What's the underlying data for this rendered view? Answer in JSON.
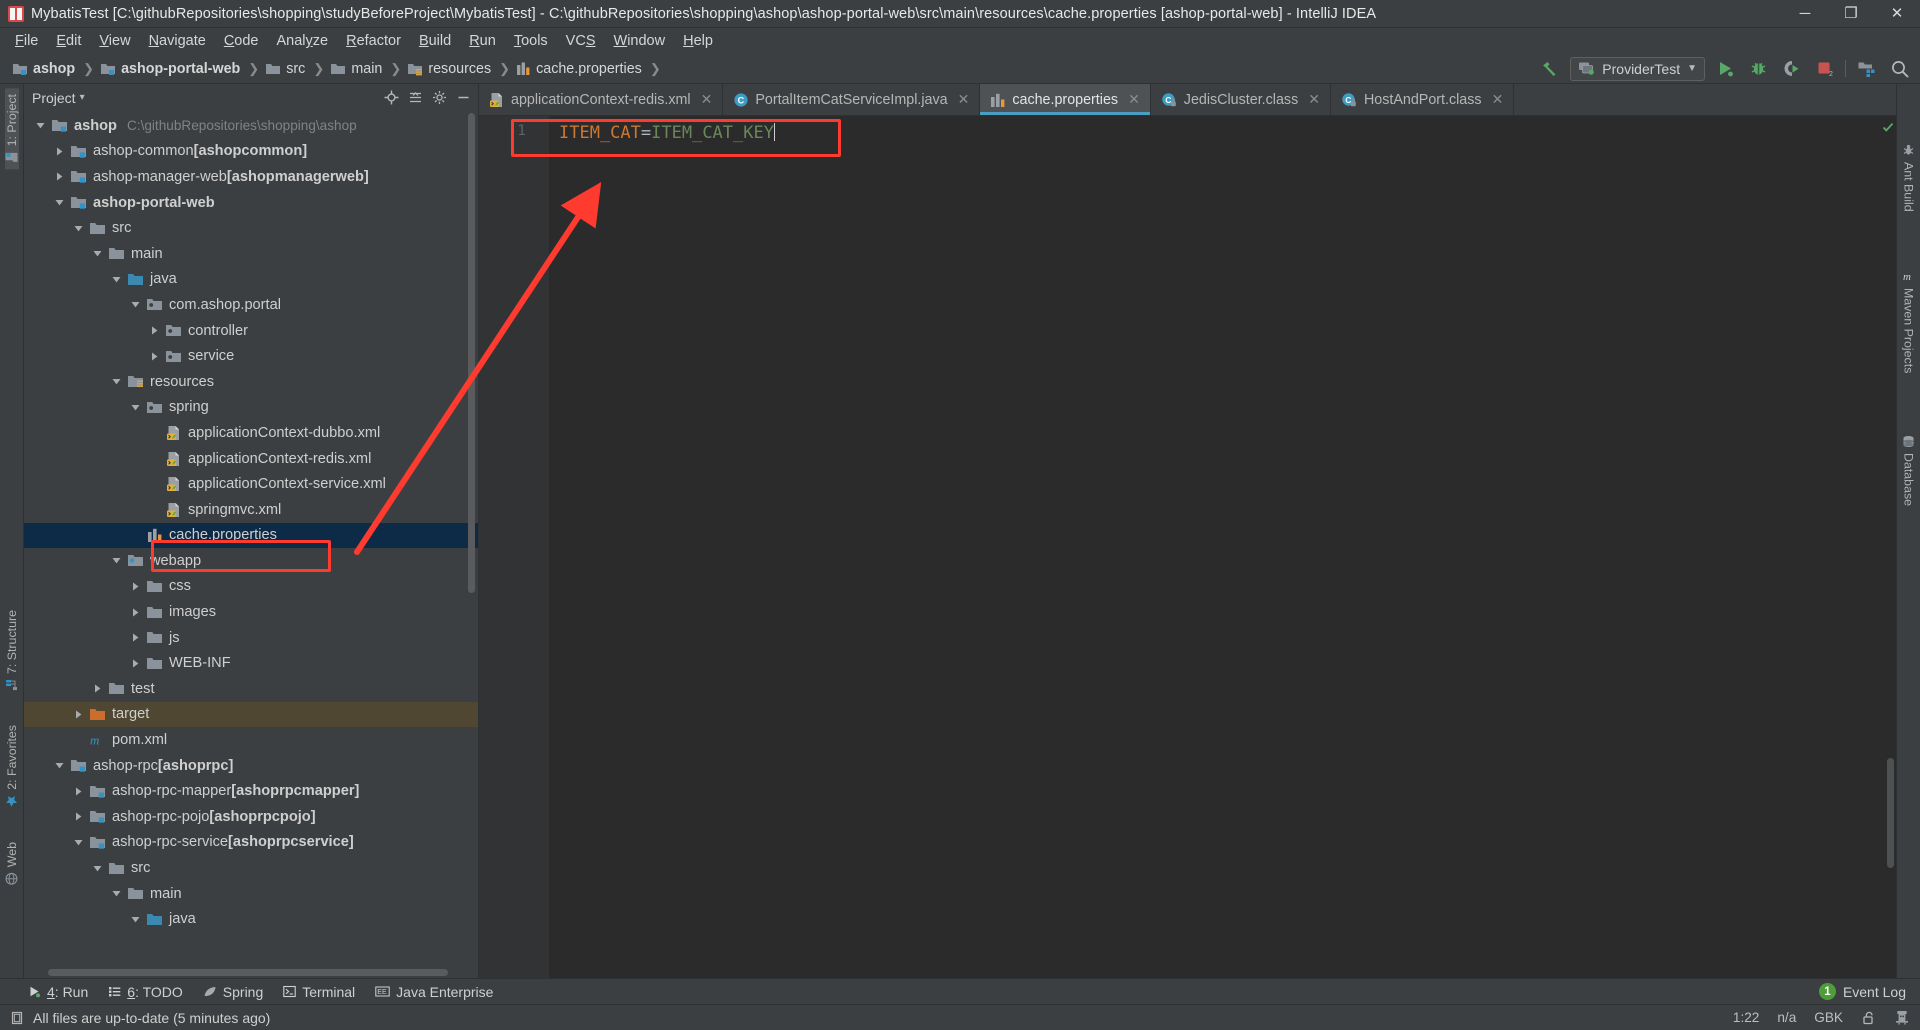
{
  "window": {
    "title": "MybatisTest [C:\\githubRepositories\\shopping\\studyBeforeProject\\MybatisTest] - C:\\githubRepositories\\shopping\\ashop\\ashop-portal-web\\src\\main\\resources\\cache.properties [ashop-portal-web] - IntelliJ IDEA",
    "app_icon": "intellij-idea-icon",
    "minimize": "─",
    "maximize": "❐",
    "close": "✕"
  },
  "menubar": {
    "items": [
      {
        "label": "File",
        "mnemonic": "F"
      },
      {
        "label": "Edit",
        "mnemonic": "E"
      },
      {
        "label": "View",
        "mnemonic": "V"
      },
      {
        "label": "Navigate",
        "mnemonic": "N"
      },
      {
        "label": "Code",
        "mnemonic": "C"
      },
      {
        "label": "Analyze",
        "mnemonic": "y"
      },
      {
        "label": "Refactor",
        "mnemonic": "R"
      },
      {
        "label": "Build",
        "mnemonic": "B"
      },
      {
        "label": "Run",
        "mnemonic": "R"
      },
      {
        "label": "Tools",
        "mnemonic": "T"
      },
      {
        "label": "VCS",
        "mnemonic": "S"
      },
      {
        "label": "Window",
        "mnemonic": "W"
      },
      {
        "label": "Help",
        "mnemonic": "H"
      }
    ]
  },
  "navbar": {
    "breadcrumbs": [
      {
        "label": "ashop",
        "icon": "module-icon"
      },
      {
        "label": "ashop-portal-web",
        "icon": "module-icon"
      },
      {
        "label": "src",
        "icon": "folder-icon"
      },
      {
        "label": "main",
        "icon": "folder-icon"
      },
      {
        "label": "resources",
        "icon": "resources-folder-icon"
      },
      {
        "label": "cache.properties",
        "icon": "properties-file-icon"
      }
    ],
    "separator": "❯",
    "run_config": {
      "label": "ProviderTest",
      "icon": "run-config-icon",
      "dropdown_arrow": "▼"
    },
    "buttons": [
      {
        "name": "build-button",
        "icon": "hammer-icon"
      },
      {
        "name": "run-button",
        "icon": "play-icon"
      },
      {
        "name": "debug-button",
        "icon": "bug-icon"
      },
      {
        "name": "run-with-coverage-button",
        "icon": "coverage-icon"
      },
      {
        "name": "stop-button",
        "icon": "stop-icon"
      },
      {
        "name": "project-structure-button",
        "icon": "project-structure-icon"
      },
      {
        "name": "search-everywhere-button",
        "icon": "search-icon"
      }
    ]
  },
  "left_strip": {
    "tabs": [
      {
        "label": "1: Project",
        "icon": "project-icon",
        "active": true
      },
      {
        "label": "7: Structure",
        "icon": "structure-icon",
        "active": false
      },
      {
        "label": "2: Favorites",
        "icon": "favorites-star-icon",
        "active": false
      },
      {
        "label": "Web",
        "icon": "web-icon",
        "active": false
      }
    ]
  },
  "right_strip": {
    "tabs": [
      {
        "label": "Ant Build",
        "icon": "ant-icon"
      },
      {
        "label": "Maven Projects",
        "icon": "maven-icon"
      },
      {
        "label": "Database",
        "icon": "database-icon"
      }
    ]
  },
  "project_panel": {
    "title": "Project",
    "title_dropdown": "▾",
    "tools": [
      {
        "name": "locate-file-button",
        "icon": "target-icon"
      },
      {
        "name": "collapse-all-button",
        "icon": "collapse-all-icon"
      },
      {
        "name": "settings-button",
        "icon": "gear-icon"
      },
      {
        "name": "hide-button",
        "icon": "minus-icon"
      }
    ],
    "tree": [
      {
        "depth": 0,
        "label": "ashop",
        "bold": true,
        "path": "C:\\githubRepositories\\shopping\\ashop",
        "icon": "module-icon",
        "arrow": "down"
      },
      {
        "depth": 1,
        "label": "ashop-common ",
        "suffix": "[ashopcommon]",
        "icon": "module-icon",
        "arrow": "right"
      },
      {
        "depth": 1,
        "label": "ashop-manager-web ",
        "suffix": "[ashopmanagerweb]",
        "icon": "module-icon",
        "arrow": "right"
      },
      {
        "depth": 1,
        "label": "ashop-portal-web",
        "bold": true,
        "icon": "module-icon",
        "arrow": "down"
      },
      {
        "depth": 2,
        "label": "src",
        "icon": "folder-icon",
        "arrow": "down"
      },
      {
        "depth": 3,
        "label": "main",
        "icon": "folder-icon",
        "arrow": "down"
      },
      {
        "depth": 4,
        "label": "java",
        "icon": "source-folder-icon",
        "arrow": "down"
      },
      {
        "depth": 5,
        "label": "com.ashop.portal",
        "icon": "package-icon",
        "arrow": "down"
      },
      {
        "depth": 6,
        "label": "controller",
        "icon": "package-icon",
        "arrow": "right"
      },
      {
        "depth": 6,
        "label": "service",
        "icon": "package-icon",
        "arrow": "right"
      },
      {
        "depth": 4,
        "label": "resources",
        "icon": "resources-folder-icon",
        "arrow": "down"
      },
      {
        "depth": 5,
        "label": "spring",
        "icon": "package-icon",
        "arrow": "down"
      },
      {
        "depth": 6,
        "label": "applicationContext-dubbo.xml",
        "icon": "spring-xml-icon",
        "arrow": "none"
      },
      {
        "depth": 6,
        "label": "applicationContext-redis.xml",
        "icon": "spring-xml-icon",
        "arrow": "none"
      },
      {
        "depth": 6,
        "label": "applicationContext-service.xml",
        "icon": "spring-xml-icon",
        "arrow": "none"
      },
      {
        "depth": 6,
        "label": "springmvc.xml",
        "icon": "spring-xml-icon",
        "arrow": "none"
      },
      {
        "depth": 5,
        "label": "cache.properties",
        "icon": "properties-file-icon",
        "arrow": "none",
        "selected": true
      },
      {
        "depth": 4,
        "label": "webapp",
        "icon": "webapp-folder-icon",
        "arrow": "down"
      },
      {
        "depth": 5,
        "label": "css",
        "icon": "folder-icon",
        "arrow": "right"
      },
      {
        "depth": 5,
        "label": "images",
        "icon": "folder-icon",
        "arrow": "right"
      },
      {
        "depth": 5,
        "label": "js",
        "icon": "folder-icon",
        "arrow": "right"
      },
      {
        "depth": 5,
        "label": "WEB-INF",
        "icon": "folder-icon",
        "arrow": "right"
      },
      {
        "depth": 3,
        "label": "test",
        "icon": "folder-icon",
        "arrow": "right"
      },
      {
        "depth": 2,
        "label": "target",
        "icon": "excluded-folder-icon",
        "arrow": "right",
        "excluded": true
      },
      {
        "depth": 2,
        "label": "pom.xml",
        "icon": "maven-pom-icon",
        "arrow": "none"
      },
      {
        "depth": 1,
        "label": "ashop-rpc ",
        "suffix": "[ashoprpc]",
        "icon": "module-icon",
        "arrow": "down"
      },
      {
        "depth": 2,
        "label": "ashop-rpc-mapper ",
        "suffix": "[ashoprpcmapper]",
        "icon": "module-icon",
        "arrow": "right"
      },
      {
        "depth": 2,
        "label": "ashop-rpc-pojo ",
        "suffix": "[ashoprpcpojo]",
        "icon": "module-icon",
        "arrow": "right"
      },
      {
        "depth": 2,
        "label": "ashop-rpc-service ",
        "suffix": "[ashoprpcservice]",
        "icon": "module-icon",
        "arrow": "down"
      },
      {
        "depth": 3,
        "label": "src",
        "icon": "folder-icon",
        "arrow": "down"
      },
      {
        "depth": 4,
        "label": "main",
        "icon": "folder-icon",
        "arrow": "down"
      },
      {
        "depth": 5,
        "label": "java",
        "icon": "source-folder-icon",
        "arrow": "down"
      }
    ]
  },
  "editor": {
    "tabs": [
      {
        "label": "applicationContext-redis.xml",
        "icon": "spring-xml-icon",
        "active": false,
        "close": "✕"
      },
      {
        "label": "PortalItemCatServiceImpl.java",
        "icon": "java-class-icon",
        "active": false,
        "close": "✕"
      },
      {
        "label": "cache.properties",
        "icon": "properties-file-icon",
        "active": true,
        "close": "✕"
      },
      {
        "label": "JedisCluster.class",
        "icon": "java-class-locked-icon",
        "active": false,
        "close": "✕"
      },
      {
        "label": "HostAndPort.class",
        "icon": "java-class-locked-icon",
        "active": false,
        "close": "✕"
      }
    ],
    "line_numbers": [
      "1"
    ],
    "line1": {
      "key": "ITEM_CAT",
      "equals": "=",
      "value": "ITEM_CAT_KEY"
    },
    "inspection_status": "ok-check-icon"
  },
  "annotations": {
    "editor_box": "red-rectangle-highlight",
    "tree_box": "red-rectangle-highlight",
    "arrow": "red-arrow-annotation",
    "color": "#ff3b30"
  },
  "toolwindow_bar": {
    "items": [
      {
        "label": "4: Run",
        "mnemonic": "4",
        "icon": "run-icon"
      },
      {
        "label": "6: TODO",
        "mnemonic": "6",
        "icon": "todo-icon"
      },
      {
        "label": "Spring",
        "icon": "spring-leaf-icon"
      },
      {
        "label": "Terminal",
        "icon": "terminal-icon"
      },
      {
        "label": "Java Enterprise",
        "icon": "java-ee-icon"
      }
    ],
    "event_log": {
      "label": "Event Log",
      "count": "1"
    }
  },
  "statusbar": {
    "icon": "memory-icon",
    "message": "All files are up-to-date (5 minutes ago)",
    "caret_position": "1:22",
    "line_separator": "n/a",
    "encoding": "GBK",
    "lock_icon": "unlock-icon",
    "inspection_icon": "hector-icon"
  }
}
